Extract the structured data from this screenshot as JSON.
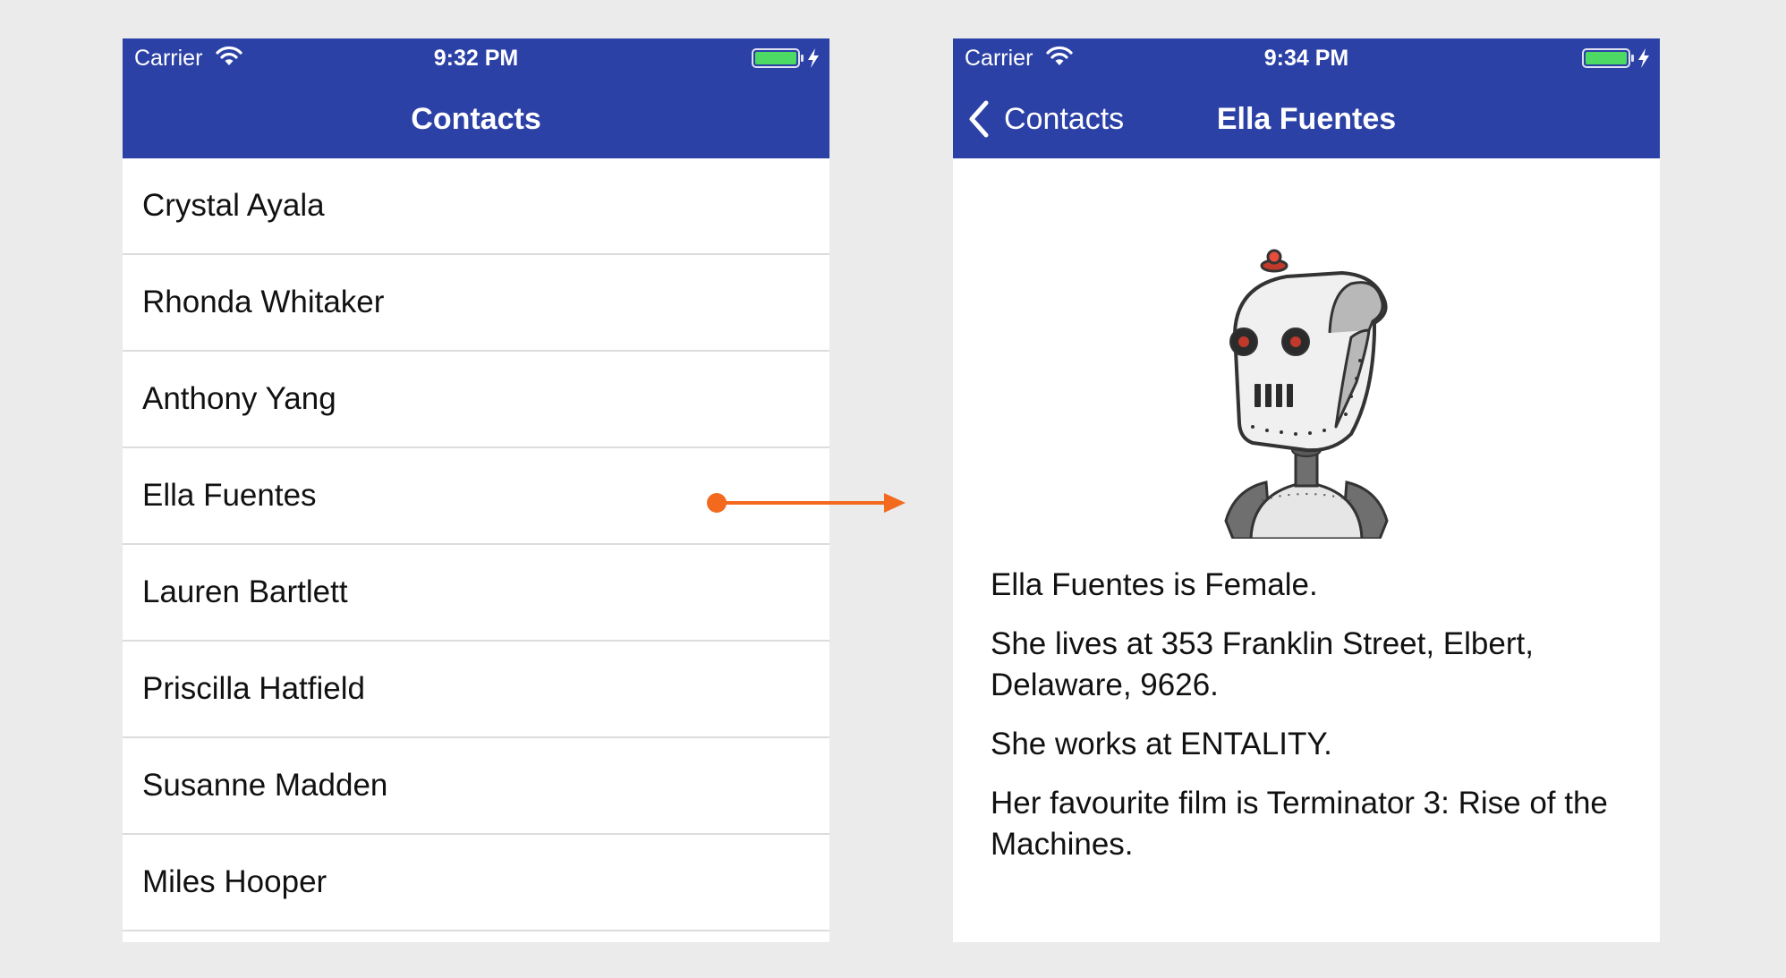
{
  "colors": {
    "background": "#ebebeb",
    "navbar": "#2c41a6",
    "battery": "#4cd964",
    "arrow": "#f36a1f",
    "separator": "#dcdcdc"
  },
  "left_screen": {
    "status_bar": {
      "carrier": "Carrier",
      "time": "9:32 PM",
      "icons": [
        "wifi-icon",
        "battery-icon",
        "charging-bolt-icon"
      ]
    },
    "nav_title": "Contacts",
    "contacts": [
      "Crystal Ayala",
      "Rhonda Whitaker",
      "Anthony Yang",
      "Ella Fuentes",
      "Lauren Bartlett",
      "Priscilla Hatfield",
      "Susanne Madden",
      "Miles Hooper"
    ]
  },
  "right_screen": {
    "status_bar": {
      "carrier": "Carrier",
      "time": "9:34 PM",
      "icons": [
        "wifi-icon",
        "battery-icon",
        "charging-bolt-icon"
      ]
    },
    "back_label": "Contacts",
    "back_icon": "chevron-left-icon",
    "nav_title": "Ella Fuentes",
    "avatar_icon": "robot-avatar",
    "details": {
      "gender": "Ella Fuentes is Female.",
      "address": "She lives at 353 Franklin Street, Elbert, Delaware, 9626.",
      "work": "She works at ENTALITY.",
      "film": "Her favourite film is Terminator 3: Rise of the Machines."
    }
  },
  "annotation": {
    "arrow_icon": "arrow-right-icon",
    "from_contact": "Ella Fuentes"
  }
}
